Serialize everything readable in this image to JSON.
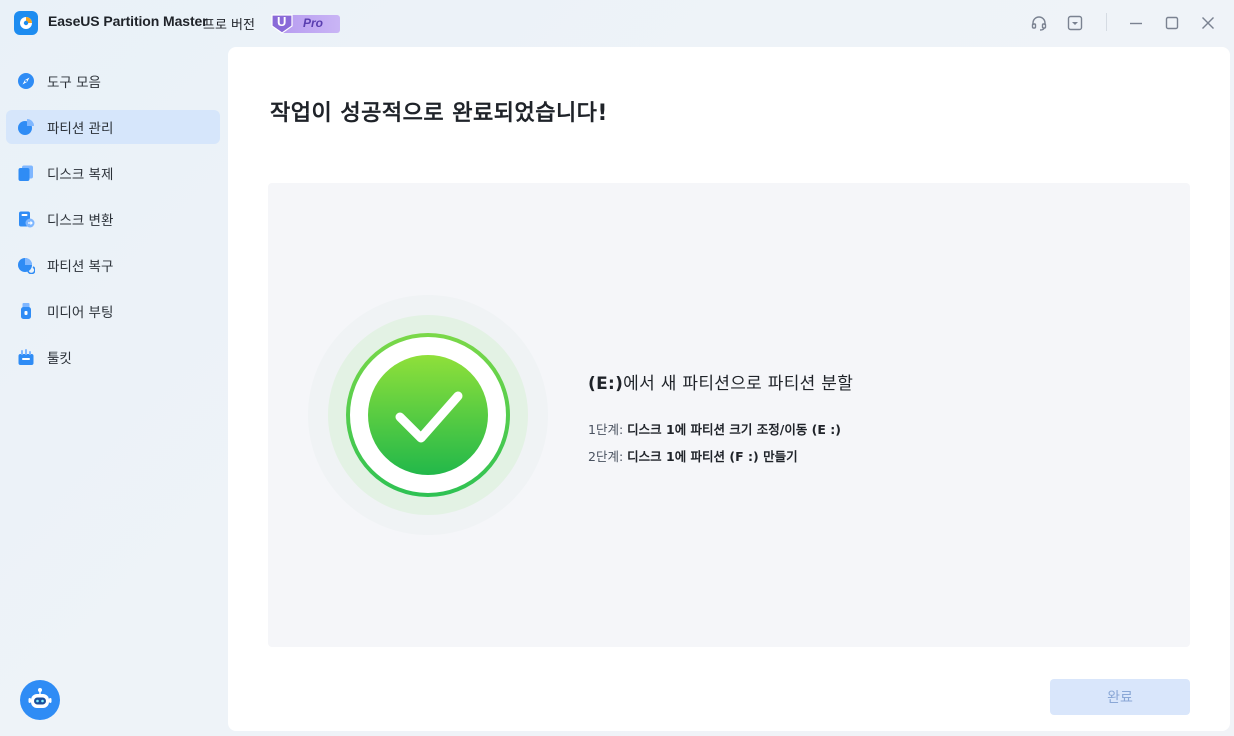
{
  "app": {
    "title": "EaseUS Partition Master",
    "edition": "프로 버전",
    "badge_letter": "U",
    "badge_text": "Pro"
  },
  "sidebar": {
    "items": [
      {
        "label": "도구 모음",
        "icon": "compass-icon",
        "active": false
      },
      {
        "label": "파티션 관리",
        "icon": "pie-chart-icon",
        "active": true
      },
      {
        "label": "디스크 복제",
        "icon": "clone-icon",
        "active": false
      },
      {
        "label": "디스크 변환",
        "icon": "disk-convert-icon",
        "active": false
      },
      {
        "label": "파티션 복구",
        "icon": "partition-recovery-icon",
        "active": false
      },
      {
        "label": "미디어 부팅",
        "icon": "usb-drive-icon",
        "active": false
      },
      {
        "label": "툴킷",
        "icon": "toolkit-icon",
        "active": false
      }
    ]
  },
  "main": {
    "title": "작업이 성공적으로 완료되었습니다!",
    "result": {
      "heading_bold": "(E:)",
      "heading_rest": "에서 새 파티션으로 파티션 분할",
      "steps": [
        {
          "prefix": "1단계:",
          "text": "디스크 1에 파티션 크기 조정/이동 (E :)"
        },
        {
          "prefix": "2단계:",
          "text": "디스크 1에 파티션 (F :) 만들기"
        }
      ]
    },
    "done_label": "완료"
  },
  "colors": {
    "accent": "#2f8cf5",
    "success": "#3cc94a",
    "active_nav": "#d6e6fb"
  }
}
